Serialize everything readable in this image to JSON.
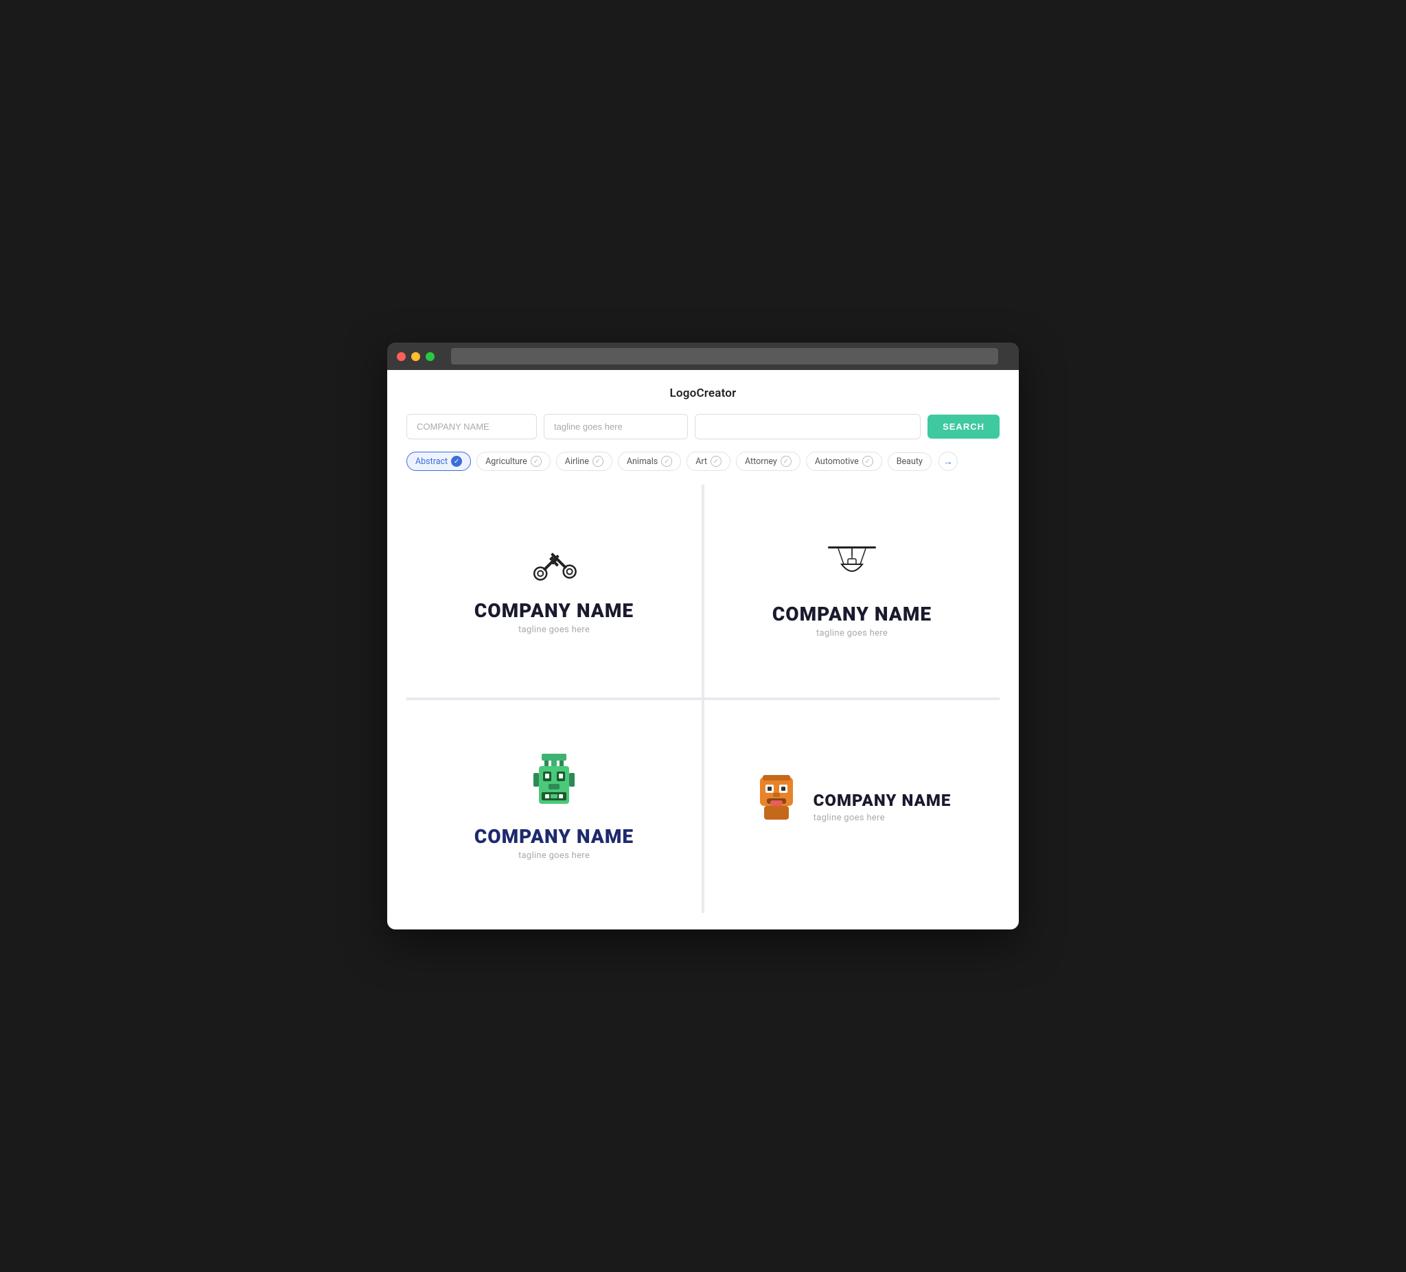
{
  "app": {
    "title": "LogoCreator"
  },
  "search": {
    "company_placeholder": "COMPANY NAME",
    "tagline_placeholder": "tagline goes here",
    "extra_placeholder": "",
    "button_label": "SEARCH"
  },
  "categories": [
    {
      "id": "abstract",
      "label": "Abstract",
      "active": true
    },
    {
      "id": "agriculture",
      "label": "Agriculture",
      "active": false
    },
    {
      "id": "airline",
      "label": "Airline",
      "active": false
    },
    {
      "id": "animals",
      "label": "Animals",
      "active": false
    },
    {
      "id": "art",
      "label": "Art",
      "active": false
    },
    {
      "id": "attorney",
      "label": "Attorney",
      "active": false
    },
    {
      "id": "automotive",
      "label": "Automotive",
      "active": false
    },
    {
      "id": "beauty",
      "label": "Beauty",
      "active": false
    }
  ],
  "logos": [
    {
      "id": "logo1",
      "company_name": "COMPANY NAME",
      "tagline": "tagline goes here",
      "icon_type": "crossed-keys"
    },
    {
      "id": "logo2",
      "company_name": "COMPANY NAME",
      "tagline": "tagline goes here",
      "icon_type": "hanging-lamp"
    },
    {
      "id": "logo3",
      "company_name": "COMPANY NAME",
      "tagline": "tagline goes here",
      "icon_type": "tiki-mask"
    },
    {
      "id": "logo4",
      "company_name": "COMPANY NAME",
      "tagline": "tagline goes here",
      "icon_type": "character"
    }
  ],
  "colors": {
    "accent": "#3ec9a0",
    "active_category": "#3a6fd8",
    "logo1_name": "#1a1a2e",
    "logo3_name": "#1e2a6e"
  }
}
